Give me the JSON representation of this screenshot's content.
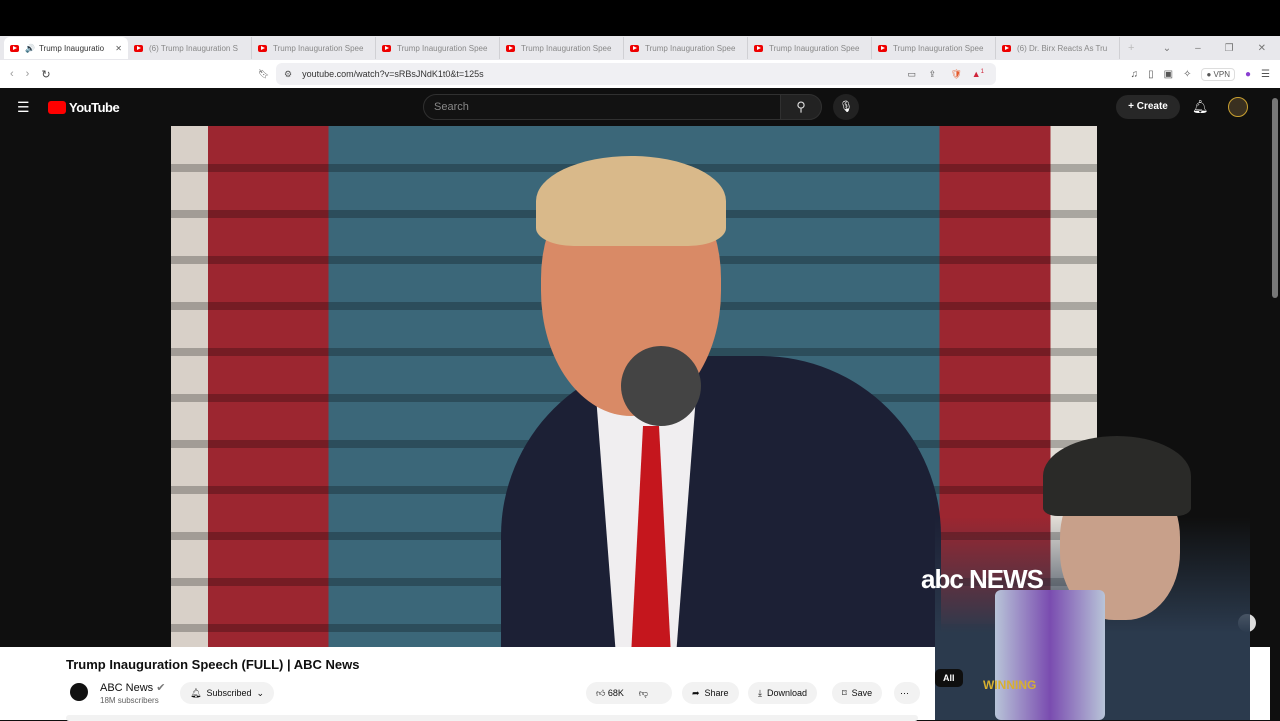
{
  "browser": {
    "tabs": [
      {
        "label": "Trump Inauguratio",
        "active": true
      },
      {
        "label": "(6) Trump Inauguration S"
      },
      {
        "label": "Trump Inauguration Spee"
      },
      {
        "label": "Trump Inauguration Spee"
      },
      {
        "label": "Trump Inauguration Spee"
      },
      {
        "label": "Trump Inauguration Spee"
      },
      {
        "label": "Trump Inauguration Spee"
      },
      {
        "label": "Trump Inauguration Spee"
      },
      {
        "label": "(6) Dr. Birx Reacts As Tru"
      }
    ],
    "url": "youtube.com/watch?v=sRBsJNdK1t0&t=125s",
    "vpn_label": "VPN",
    "shields_badge": "1"
  },
  "youtube": {
    "logo": "YouTube",
    "search_placeholder": "Search",
    "create_label": "Create",
    "video_overlay": "abc NEWS",
    "webcam_mug_text": "WINNING",
    "title": "Trump Inauguration Speech (FULL) | ABC News",
    "channel": "ABC News",
    "subscribers": "18M subscribers",
    "subscribed_label": "Subscribed",
    "likes": "68K",
    "share_label": "Share",
    "download_label": "Download",
    "save_label": "Save",
    "all_chip": "All"
  },
  "colors": {
    "brand_red": "#ff0000",
    "tie_red": "#c5161d"
  }
}
